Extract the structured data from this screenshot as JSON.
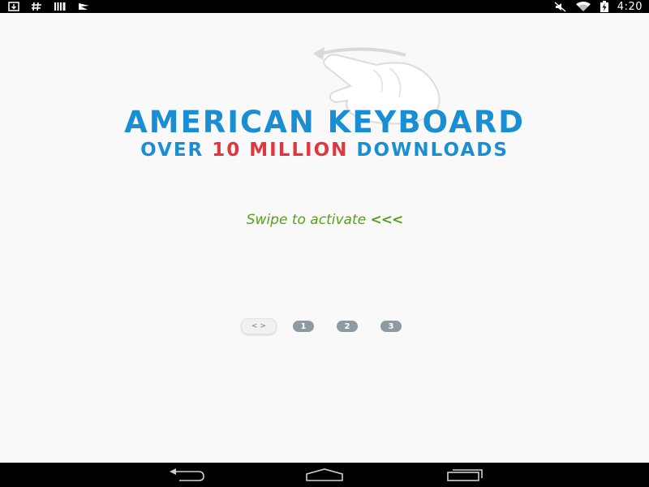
{
  "status_bar": {
    "left_icons": [
      "download-icon",
      "hash-icon",
      "barcode-icon",
      "notification-flag-icon"
    ],
    "right_icons": [
      "mute-icon",
      "wifi-icon",
      "battery-charging-icon"
    ],
    "time": "4:20"
  },
  "hero": {
    "hand_icon": "swipe-hand-icon",
    "title": "AMERICAN KEYBOARD",
    "subtitle_prefix": "OVER ",
    "subtitle_highlight": "10 MILLION",
    "subtitle_suffix": " DOWNLOADS"
  },
  "swipe": {
    "text": "Swipe to activate",
    "arrows": "<<<"
  },
  "pager": {
    "current_label": "< >",
    "pages": [
      "1",
      "2",
      "3"
    ]
  },
  "nav_bar": {
    "buttons": [
      "back-icon",
      "home-icon",
      "recent-apps-icon"
    ]
  },
  "colors": {
    "title_blue": "#1a8ed3",
    "highlight_red": "#e0373f",
    "swipe_green": "#5a9e1c",
    "pager_gray": "#8e9aa2"
  }
}
